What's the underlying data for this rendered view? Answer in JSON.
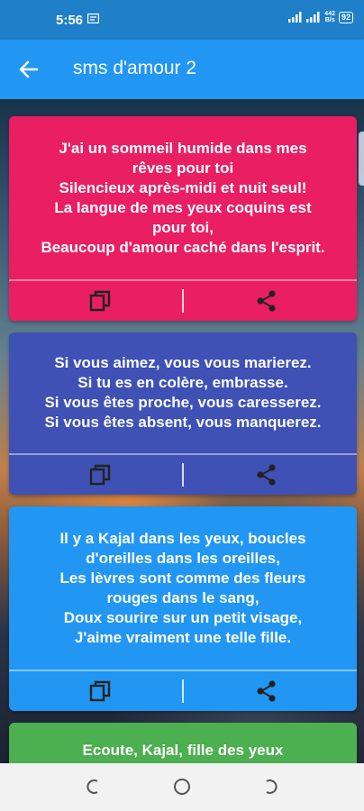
{
  "status_bar": {
    "time": "5:56",
    "speed_value": "442",
    "speed_unit": "B/s",
    "battery": "92"
  },
  "app_bar": {
    "title": "sms d'amour 2",
    "back_icon": "arrow-back-icon"
  },
  "cards": [
    {
      "color": "#e91e63",
      "text": "J'ai un sommeil humide dans mes\nrêves pour toi\nSilencieux après-midi et nuit seul!\nLa langue de mes yeux coquins est\npour toi,\nBeaucoup d'amour caché dans l'esprit."
    },
    {
      "color": "#3f51b5",
      "text": "Si vous aimez, vous vous marierez.\nSi tu es en colère, embrasse.\nSi vous êtes proche, vous caresserez.\nSi vous êtes absent, vous manquerez."
    },
    {
      "color": "#2196f3",
      "text": "Il y a Kajal dans les yeux, boucles\nd'oreilles dans les oreilles,\nLes lèvres sont comme des fleurs\nrouges dans le sang,\nDoux sourire sur un petit visage,\nJ'aime vraiment une telle fille."
    },
    {
      "color": "#4caf50",
      "text": "Ecoute, Kajal, fille des yeux"
    }
  ],
  "card_actions": {
    "copy_icon": "copy-icon",
    "share_icon": "share-icon"
  },
  "nav_bar": {
    "items": [
      "recent-apps-icon",
      "home-icon",
      "back-icon"
    ]
  }
}
